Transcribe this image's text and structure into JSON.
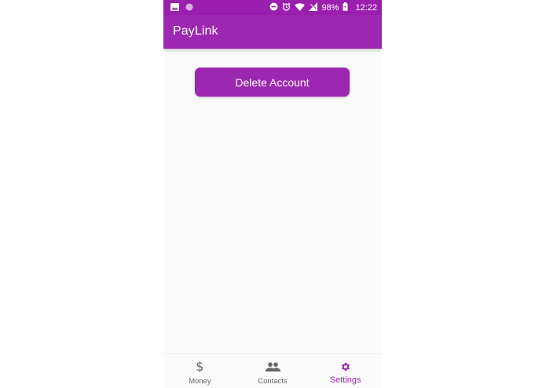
{
  "status_bar": {
    "battery": "98%",
    "time": "12:22",
    "left_icons": [
      "image-icon",
      "circle-app-icon"
    ],
    "right_icons": [
      "do-not-disturb-icon",
      "alarm-icon",
      "wifi-icon",
      "no-signal-icon",
      "battery-icon"
    ]
  },
  "app_bar": {
    "title": "PayLink"
  },
  "main": {
    "delete_button_label": "Delete Account"
  },
  "bottom_nav": {
    "items": [
      {
        "label": "Money",
        "icon": "dollar-icon",
        "active": false
      },
      {
        "label": "Contacts",
        "icon": "people-icon",
        "active": false
      },
      {
        "label": "Settings",
        "icon": "gear-icon",
        "active": true
      }
    ]
  },
  "colors": {
    "primary": "#9c27b0",
    "status_bar": "#9a1fae",
    "background": "#fafafa",
    "inactive": "#666666"
  }
}
